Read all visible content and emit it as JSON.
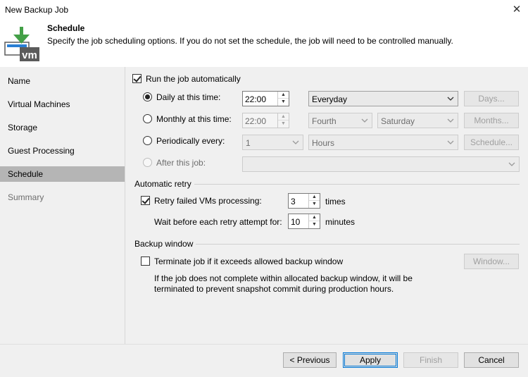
{
  "window": {
    "title": "New Backup Job"
  },
  "header": {
    "title": "Schedule",
    "description": "Specify the job scheduling options. If you do not set the schedule, the job will need to be controlled manually.",
    "logo_text": "vm"
  },
  "sidebar": {
    "items": [
      {
        "label": "Name",
        "state": "normal"
      },
      {
        "label": "Virtual Machines",
        "state": "normal"
      },
      {
        "label": "Storage",
        "state": "normal"
      },
      {
        "label": "Guest Processing",
        "state": "normal"
      },
      {
        "label": "Schedule",
        "state": "active"
      },
      {
        "label": "Summary",
        "state": "disabled"
      }
    ]
  },
  "schedule": {
    "run_automatically": {
      "label": "Run the job automatically",
      "checked": true
    },
    "daily": {
      "label": "Daily at this time:",
      "time": "22:00",
      "frequency": "Everyday",
      "button": "Days..."
    },
    "monthly": {
      "label": "Monthly at this time:",
      "time": "22:00",
      "week": "Fourth",
      "day": "Saturday",
      "button": "Months..."
    },
    "periodically": {
      "label": "Periodically every:",
      "value": "1",
      "unit": "Hours",
      "button": "Schedule..."
    },
    "after_job": {
      "label": "After this job:",
      "value": ""
    }
  },
  "retry": {
    "section_label": "Automatic retry",
    "retry_failed": {
      "label": "Retry failed VMs processing:",
      "checked": true,
      "value": "3",
      "unit": "times"
    },
    "wait": {
      "label": "Wait before each retry attempt for:",
      "value": "10",
      "unit": "minutes"
    }
  },
  "backup_window": {
    "section_label": "Backup window",
    "terminate": {
      "label": "Terminate job if it exceeds allowed backup window",
      "checked": false
    },
    "button": "Window...",
    "note_line1": "If the job does not complete within allocated backup window, it will be",
    "note_line2": "terminated to prevent snapshot commit during production hours."
  },
  "footer": {
    "previous": "< Previous",
    "apply": "Apply",
    "finish": "Finish",
    "cancel": "Cancel"
  }
}
